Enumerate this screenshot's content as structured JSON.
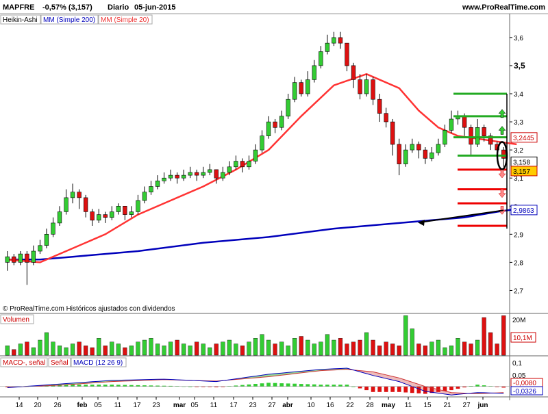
{
  "header": {
    "ticker": "MAPFRE",
    "change": "-0,57% (3,157)",
    "period": "Diario",
    "date": "05-jun-2015",
    "site": "www.ProRealTime.com"
  },
  "legend": {
    "chart_style": "Heikin-Ashi",
    "ma200": "MM (Simple 200)",
    "ma20": "MM (Simple 20)"
  },
  "footer_note": "© ProRealTime.com  Históricos ajustados con dividendos",
  "volume_panel": {
    "title": "Volumen",
    "max_label": "20M",
    "last_label": "10,1M"
  },
  "macd_panel": {
    "title_hist": "MACD-, señal",
    "title_signal": "Señal",
    "title_macd": "MACD (12 26 9)",
    "ticks": [
      "0,1",
      "0,05",
      "0"
    ],
    "labels": [
      "-0,0080",
      "-0,0326"
    ]
  },
  "price_axis": {
    "ticks": [
      "3,6",
      "3,5",
      "3,4",
      "3,3",
      "3,2",
      "3,1",
      "3",
      "2,9",
      "2,8",
      "2,7"
    ],
    "badges": [
      "3,2445",
      "3,158",
      "3,157",
      "2,9863"
    ]
  },
  "date_axis": [
    "14",
    "20",
    "26",
    "feb",
    "05",
    "11",
    "17",
    "23",
    "mar",
    "05",
    "11",
    "17",
    "23",
    "27",
    "abr",
    "10",
    "16",
    "22",
    "28",
    "may",
    "11",
    "15",
    "21",
    "27",
    "jun"
  ],
  "colors": {
    "bull": "#33cc33",
    "bear": "#dd1111",
    "ma20": "#ff3333",
    "ma200": "#0000bb",
    "macd_fill_green": "#99dd99",
    "macd_fill_red": "#eebbbb",
    "support": "#22aa22",
    "resistance": "#ee0000"
  },
  "chart_data": {
    "type": "candlestick",
    "style": "Heikin-Ashi",
    "candles": [
      {
        "o": 2.8,
        "c": 2.82,
        "h": 2.84,
        "l": 2.77
      },
      {
        "o": 2.82,
        "c": 2.8,
        "h": 2.83,
        "l": 2.79
      },
      {
        "o": 2.8,
        "c": 2.83,
        "h": 2.84,
        "l": 2.79
      },
      {
        "o": 2.83,
        "c": 2.8,
        "h": 2.84,
        "l": 2.72
      },
      {
        "o": 2.8,
        "c": 2.84,
        "h": 2.86,
        "l": 2.79
      },
      {
        "o": 2.84,
        "c": 2.86,
        "h": 2.88,
        "l": 2.83
      },
      {
        "o": 2.86,
        "c": 2.9,
        "h": 2.92,
        "l": 2.85
      },
      {
        "o": 2.9,
        "c": 2.94,
        "h": 2.96,
        "l": 2.89
      },
      {
        "o": 2.94,
        "c": 2.98,
        "h": 3.0,
        "l": 2.93
      },
      {
        "o": 2.98,
        "c": 3.03,
        "h": 3.06,
        "l": 2.97
      },
      {
        "o": 3.03,
        "c": 3.05,
        "h": 3.08,
        "l": 3.01
      },
      {
        "o": 3.05,
        "c": 3.03,
        "h": 3.06,
        "l": 2.99
      },
      {
        "o": 3.03,
        "c": 2.98,
        "h": 3.04,
        "l": 2.96
      },
      {
        "o": 2.98,
        "c": 2.95,
        "h": 2.99,
        "l": 2.93
      },
      {
        "o": 2.95,
        "c": 2.97,
        "h": 2.99,
        "l": 2.94
      },
      {
        "o": 2.97,
        "c": 2.96,
        "h": 2.98,
        "l": 2.94
      },
      {
        "o": 2.96,
        "c": 2.98,
        "h": 3.0,
        "l": 2.95
      },
      {
        "o": 2.98,
        "c": 3.0,
        "h": 3.01,
        "l": 2.97
      },
      {
        "o": 3.0,
        "c": 2.97,
        "h": 3.0,
        "l": 2.95
      },
      {
        "o": 2.97,
        "c": 2.98,
        "h": 3.0,
        "l": 2.96
      },
      {
        "o": 2.98,
        "c": 3.02,
        "h": 3.04,
        "l": 2.97
      },
      {
        "o": 3.02,
        "c": 3.05,
        "h": 3.07,
        "l": 3.01
      },
      {
        "o": 3.05,
        "c": 3.07,
        "h": 3.09,
        "l": 3.04
      },
      {
        "o": 3.07,
        "c": 3.09,
        "h": 3.11,
        "l": 3.06
      },
      {
        "o": 3.09,
        "c": 3.1,
        "h": 3.12,
        "l": 3.08
      },
      {
        "o": 3.1,
        "c": 3.11,
        "h": 3.13,
        "l": 3.09
      },
      {
        "o": 3.11,
        "c": 3.1,
        "h": 3.12,
        "l": 3.08
      },
      {
        "o": 3.1,
        "c": 3.11,
        "h": 3.13,
        "l": 3.09
      },
      {
        "o": 3.11,
        "c": 3.12,
        "h": 3.14,
        "l": 3.1
      },
      {
        "o": 3.12,
        "c": 3.11,
        "h": 3.13,
        "l": 3.09
      },
      {
        "o": 3.11,
        "c": 3.12,
        "h": 3.14,
        "l": 3.1
      },
      {
        "o": 3.12,
        "c": 3.13,
        "h": 3.15,
        "l": 3.11
      },
      {
        "o": 3.13,
        "c": 3.1,
        "h": 3.13,
        "l": 3.08
      },
      {
        "o": 3.1,
        "c": 3.12,
        "h": 3.14,
        "l": 3.09
      },
      {
        "o": 3.12,
        "c": 3.14,
        "h": 3.16,
        "l": 3.11
      },
      {
        "o": 3.14,
        "c": 3.16,
        "h": 3.18,
        "l": 3.13
      },
      {
        "o": 3.16,
        "c": 3.14,
        "h": 3.17,
        "l": 3.12
      },
      {
        "o": 3.14,
        "c": 3.16,
        "h": 3.18,
        "l": 3.13
      },
      {
        "o": 3.16,
        "c": 3.2,
        "h": 3.22,
        "l": 3.15
      },
      {
        "o": 3.2,
        "c": 3.25,
        "h": 3.27,
        "l": 3.19
      },
      {
        "o": 3.25,
        "c": 3.3,
        "h": 3.32,
        "l": 3.24
      },
      {
        "o": 3.3,
        "c": 3.28,
        "h": 3.31,
        "l": 3.26
      },
      {
        "o": 3.28,
        "c": 3.32,
        "h": 3.34,
        "l": 3.27
      },
      {
        "o": 3.32,
        "c": 3.38,
        "h": 3.4,
        "l": 3.31
      },
      {
        "o": 3.38,
        "c": 3.44,
        "h": 3.46,
        "l": 3.37
      },
      {
        "o": 3.44,
        "c": 3.4,
        "h": 3.45,
        "l": 3.39
      },
      {
        "o": 3.4,
        "c": 3.45,
        "h": 3.48,
        "l": 3.39
      },
      {
        "o": 3.45,
        "c": 3.5,
        "h": 3.52,
        "l": 3.44
      },
      {
        "o": 3.5,
        "c": 3.55,
        "h": 3.57,
        "l": 3.49
      },
      {
        "o": 3.55,
        "c": 3.58,
        "h": 3.61,
        "l": 3.54
      },
      {
        "o": 3.58,
        "c": 3.6,
        "h": 3.62,
        "l": 3.57
      },
      {
        "o": 3.6,
        "c": 3.58,
        "h": 3.62,
        "l": 3.56
      },
      {
        "o": 3.58,
        "c": 3.5,
        "h": 3.58,
        "l": 3.48
      },
      {
        "o": 3.5,
        "c": 3.45,
        "h": 3.51,
        "l": 3.42
      },
      {
        "o": 3.45,
        "c": 3.4,
        "h": 3.47,
        "l": 3.38
      },
      {
        "o": 3.4,
        "c": 3.45,
        "h": 3.47,
        "l": 3.39
      },
      {
        "o": 3.45,
        "c": 3.38,
        "h": 3.46,
        "l": 3.36
      },
      {
        "o": 3.38,
        "c": 3.33,
        "h": 3.4,
        "l": 3.3
      },
      {
        "o": 3.33,
        "c": 3.3,
        "h": 3.35,
        "l": 3.28
      },
      {
        "o": 3.3,
        "c": 3.22,
        "h": 3.31,
        "l": 3.18
      },
      {
        "o": 3.22,
        "c": 3.15,
        "h": 3.24,
        "l": 3.11
      },
      {
        "o": 3.15,
        "c": 3.2,
        "h": 3.22,
        "l": 3.14
      },
      {
        "o": 3.2,
        "c": 3.22,
        "h": 3.24,
        "l": 3.19
      },
      {
        "o": 3.22,
        "c": 3.2,
        "h": 3.23,
        "l": 3.17
      },
      {
        "o": 3.2,
        "c": 3.17,
        "h": 3.21,
        "l": 3.15
      },
      {
        "o": 3.17,
        "c": 3.19,
        "h": 3.21,
        "l": 3.16
      },
      {
        "o": 3.19,
        "c": 3.22,
        "h": 3.24,
        "l": 3.18
      },
      {
        "o": 3.22,
        "c": 3.27,
        "h": 3.29,
        "l": 3.21
      },
      {
        "o": 3.27,
        "c": 3.31,
        "h": 3.34,
        "l": 3.26
      },
      {
        "o": 3.31,
        "c": 3.32,
        "h": 3.34,
        "l": 3.29
      },
      {
        "o": 3.32,
        "c": 3.28,
        "h": 3.33,
        "l": 3.25
      },
      {
        "o": 3.28,
        "c": 3.22,
        "h": 3.29,
        "l": 3.18
      },
      {
        "o": 3.22,
        "c": 3.28,
        "h": 3.31,
        "l": 3.21
      },
      {
        "o": 3.28,
        "c": 3.25,
        "h": 3.29,
        "l": 3.23
      },
      {
        "o": 3.25,
        "c": 3.22,
        "h": 3.26,
        "l": 3.2
      },
      {
        "o": 3.22,
        "c": 3.2,
        "h": 3.23,
        "l": 3.18
      },
      {
        "o": 3.2,
        "c": 3.17,
        "h": 3.21,
        "l": 3.14
      }
    ],
    "ma20": [
      [
        0,
        2.81
      ],
      [
        5,
        2.8
      ],
      [
        10,
        2.85
      ],
      [
        15,
        2.9
      ],
      [
        20,
        2.97
      ],
      [
        25,
        3.02
      ],
      [
        30,
        3.07
      ],
      [
        35,
        3.13
      ],
      [
        40,
        3.2
      ],
      [
        45,
        3.32
      ],
      [
        50,
        3.43
      ],
      [
        55,
        3.47
      ],
      [
        60,
        3.42
      ],
      [
        63,
        3.34
      ],
      [
        66,
        3.28
      ],
      [
        69,
        3.25
      ],
      [
        72,
        3.24
      ],
      [
        75,
        3.23
      ],
      [
        78,
        3.22
      ]
    ],
    "ma200": [
      [
        0,
        2.81
      ],
      [
        5,
        2.81
      ],
      [
        10,
        2.82
      ],
      [
        20,
        2.84
      ],
      [
        30,
        2.87
      ],
      [
        40,
        2.89
      ],
      [
        50,
        2.92
      ],
      [
        60,
        2.94
      ],
      [
        70,
        2.96
      ],
      [
        75,
        2.98
      ],
      [
        78,
        2.99
      ]
    ],
    "volume": [
      5,
      3,
      6,
      7,
      4,
      8,
      12,
      7,
      5,
      4,
      6,
      7,
      5,
      4,
      9,
      5,
      7,
      6,
      4,
      5,
      7,
      8,
      9,
      6,
      5,
      7,
      8,
      6,
      5,
      7,
      6,
      4,
      6,
      7,
      8,
      6,
      5,
      7,
      9,
      11,
      8,
      6,
      7,
      5,
      9,
      10,
      8,
      6,
      7,
      11,
      8,
      9,
      6,
      7,
      8,
      12,
      8,
      5,
      7,
      6,
      5,
      21,
      14,
      6,
      5,
      7,
      8,
      4,
      5,
      9,
      7,
      6,
      8,
      20,
      12,
      6,
      21,
      7,
      10,
      10.1
    ],
    "volume_ylim": [
      0,
      20
    ],
    "macd": [
      [
        0,
        -0.005
      ],
      [
        8,
        0.01
      ],
      [
        16,
        0.025
      ],
      [
        24,
        0.03
      ],
      [
        32,
        0.02
      ],
      [
        40,
        0.05
      ],
      [
        48,
        0.07
      ],
      [
        52,
        0.075
      ],
      [
        56,
        0.045
      ],
      [
        60,
        0.02
      ],
      [
        64,
        -0.02
      ],
      [
        68,
        -0.035
      ],
      [
        72,
        -0.025
      ],
      [
        76,
        -0.028
      ],
      [
        79,
        -0.033
      ]
    ],
    "signal": [
      [
        0,
        -0.003
      ],
      [
        8,
        0.005
      ],
      [
        16,
        0.02
      ],
      [
        24,
        0.028
      ],
      [
        32,
        0.022
      ],
      [
        40,
        0.04
      ],
      [
        48,
        0.065
      ],
      [
        52,
        0.07
      ],
      [
        56,
        0.06
      ],
      [
        60,
        0.035
      ],
      [
        64,
        0.0
      ],
      [
        68,
        -0.025
      ],
      [
        72,
        -0.03
      ],
      [
        76,
        -0.025
      ],
      [
        79,
        -0.027
      ]
    ],
    "ylim": [
      2.65,
      3.68
    ],
    "macd_ylim": [
      -0.04,
      0.12
    ],
    "support_levels": [
      3.4,
      3.32,
      3.245,
      3.18
    ],
    "resistance_levels": [
      3.13,
      3.06,
      3.01,
      2.93
    ]
  }
}
